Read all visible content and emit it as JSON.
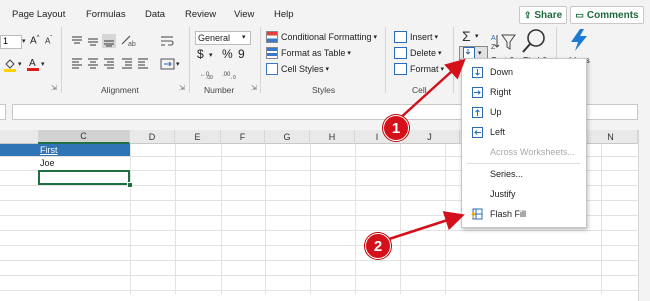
{
  "menu_tabs": [
    "Page Layout",
    "Formulas",
    "Data",
    "Review",
    "View",
    "Help"
  ],
  "share_label": "Share",
  "comments_label": "Comments",
  "font_size_fragment": "1",
  "alignment_group": "Alignment",
  "number_group": "Number",
  "number_format": "General",
  "number_symbols": {
    "currency": "$",
    "percent": "%",
    "comma": "9"
  },
  "styles_group": "Styles",
  "styles_items": [
    "Conditional Formatting",
    "Format as Table",
    "Cell Styles"
  ],
  "cells_items": [
    "Insert",
    "Delete",
    "Format"
  ],
  "cells_group_fragment": "Cell",
  "sigma": "Σ",
  "sort_label_fragment": "Sort &",
  "find_label_fragment": "Find &",
  "ideas_label": "Ideas",
  "ideas_group_fragment": "as",
  "columns": [
    "C",
    "D",
    "E",
    "F",
    "G",
    "H",
    "I",
    "J",
    "N"
  ],
  "cells": {
    "C1": "First",
    "C2": "Joe"
  },
  "fill_menu": [
    {
      "label": "Down",
      "enabled": true,
      "icon": "fill-down-icon"
    },
    {
      "label": "Right",
      "enabled": true,
      "icon": "fill-right-icon"
    },
    {
      "label": "Up",
      "enabled": true,
      "icon": "fill-up-icon"
    },
    {
      "label": "Left",
      "enabled": true,
      "icon": "fill-left-icon"
    },
    {
      "label": "Across Worksheets...",
      "enabled": false,
      "icon": ""
    },
    {
      "label": "Series...",
      "enabled": true,
      "icon": ""
    },
    {
      "label": "Justify",
      "enabled": true,
      "icon": ""
    },
    {
      "label": "Flash Fill",
      "enabled": true,
      "icon": "flash-fill-icon"
    }
  ],
  "callouts": [
    "1",
    "2"
  ],
  "colors": {
    "accent_green": "#1e6b3a",
    "header_blue": "#2f74b5",
    "arrow_red": "#d4101b"
  }
}
